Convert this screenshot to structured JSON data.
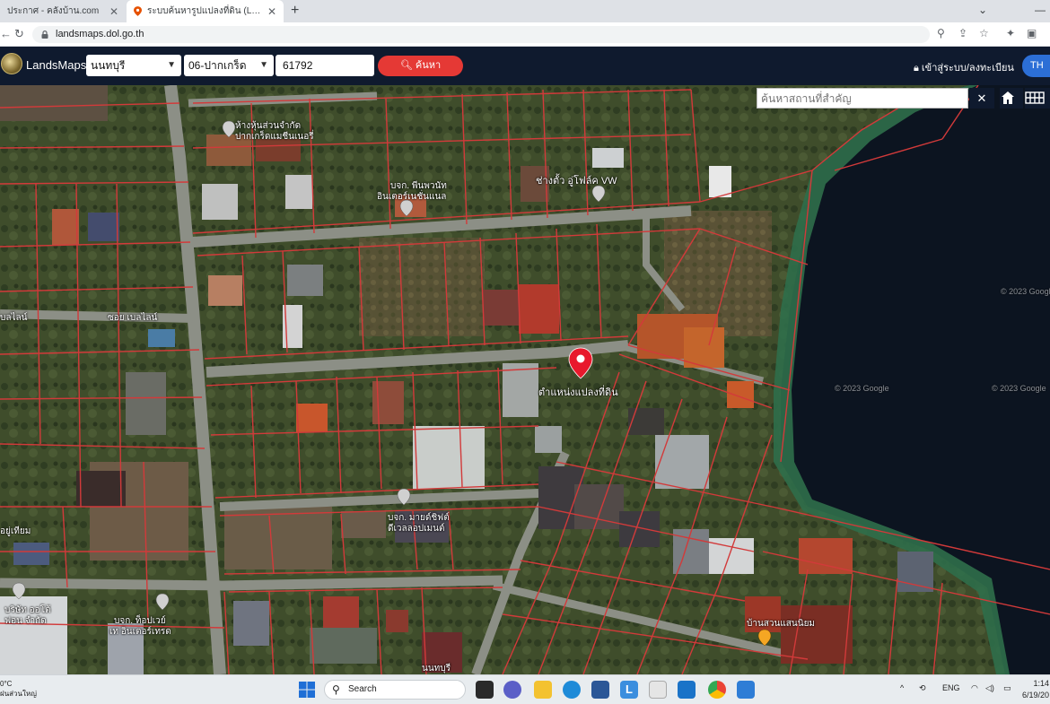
{
  "browser": {
    "tabs": [
      {
        "label": "ประกาศ - คลังบ้าน.com",
        "active": false
      },
      {
        "label": "ระบบค้นหารูปแปลงที่ดิน (LandsMaps)",
        "active": true
      }
    ],
    "url": "landsmaps.dol.go.th"
  },
  "header": {
    "brand": "LandsMaps",
    "province": "นนทบุรี",
    "district": "06-ปากเกร็ด",
    "parcel_no": "61792",
    "search_label": "ค้นหา",
    "login_label": "เข้าสู่ระบบ/ลงทะเบียน",
    "lang_label": "TH"
  },
  "map": {
    "place_search_placeholder": "ค้นหาสถานที่สำคัญ",
    "labels": {
      "shop1_line1": "ห้างหุ้นส่วนจำกัด",
      "shop1_line2": "ปากเกร็ดแมชีนเนอรี่",
      "company1_line1": "บจก. พีนพวนัท",
      "company1_line2": "อินเตอร์เนชั่นแนล",
      "garage_label": "ช่างตั้ว อู่โฟล์ค VW",
      "road_left": "บลไลน์",
      "soi_label": "ซอย เบลไลน์",
      "parcel_label": "ตำแหน่งแปลงที่ดิน",
      "company2_line1": "บจก. มายด์ชิฟต์",
      "company2_line2": "ดีเวลลอปเมนต์",
      "company3_line1": "บจก. ท็อปเวย์",
      "company3_line2": "เท อินเตอร์เทรด",
      "company4_line1": "บริษัท ออโต้",
      "company4_line2": "ฟอน จำกัด",
      "left_label": "อยู่เทียม",
      "shop2": "บ้านสวนแสนนิยม",
      "road_bottom": "นนทบุรี",
      "copyright": "© 2023 Google"
    },
    "parcel_pin_color": "#e8192c",
    "boundary_color": "#d23a3a",
    "water_color": "#0c1420"
  },
  "taskbar": {
    "weather_temp": "0°C",
    "weather_text": "ฝนส่วนใหญ่",
    "search_label": "Search",
    "lang": "ENG",
    "time": "1:14",
    "date": "6/19/20"
  }
}
